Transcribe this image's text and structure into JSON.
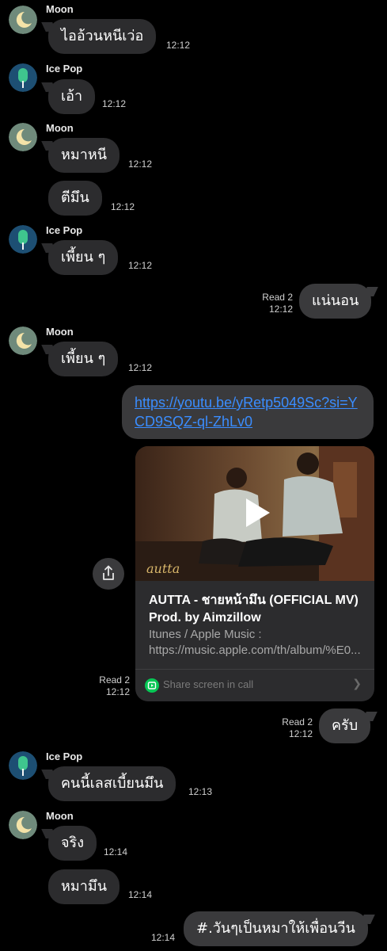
{
  "users": {
    "moon": "Moon",
    "icepop": "Ice Pop"
  },
  "messages": [
    {
      "text": "ไออ้วนหนีเว่อ",
      "time": "12:12"
    },
    {
      "text": "เอ้า",
      "time": "12:12"
    },
    {
      "text": "หมาหนี",
      "time": "12:12"
    },
    {
      "text": "ตีมึน",
      "time": "12:12"
    },
    {
      "text": "เพี้ยน ๆ",
      "time": "12:12"
    },
    {
      "text": "แน่นอน",
      "read": "Read 2",
      "time": "12:12"
    },
    {
      "text": "เพี้ยน ๆ",
      "time": "12:12"
    },
    {
      "text": "https://youtu.be/yRetp5049Sc?si=YCD9SQZ-ql-ZhLv0"
    },
    {
      "text": "ครับ",
      "read": "Read 2",
      "time": "12:12"
    },
    {
      "text": "คนนี้เลสเบี้ยนมึน",
      "time": "12:13"
    },
    {
      "text": "จริง",
      "time": "12:14"
    },
    {
      "text": "หมามึน",
      "time": "12:14"
    },
    {
      "text": "#.วันๆเป็นหมาให้เพื่อนวีน",
      "time": "12:14"
    }
  ],
  "link_preview": {
    "title": "AUTTA - ชายหน้ามึน (OFFICIAL MV) Prod. by Aimzillow",
    "description": "Itunes / Apple Music : https://music.apple.com/th/album/%E0...",
    "share_label": "Share screen in call",
    "thumbnail_signature": "autta",
    "read": "Read 2",
    "time": "12:12"
  },
  "colors": {
    "background": "#000000",
    "incoming_bubble": "#2c2c2e",
    "outgoing_bubble": "#3a3a3c",
    "link": "#3a8dff",
    "line_green": "#06c755"
  }
}
